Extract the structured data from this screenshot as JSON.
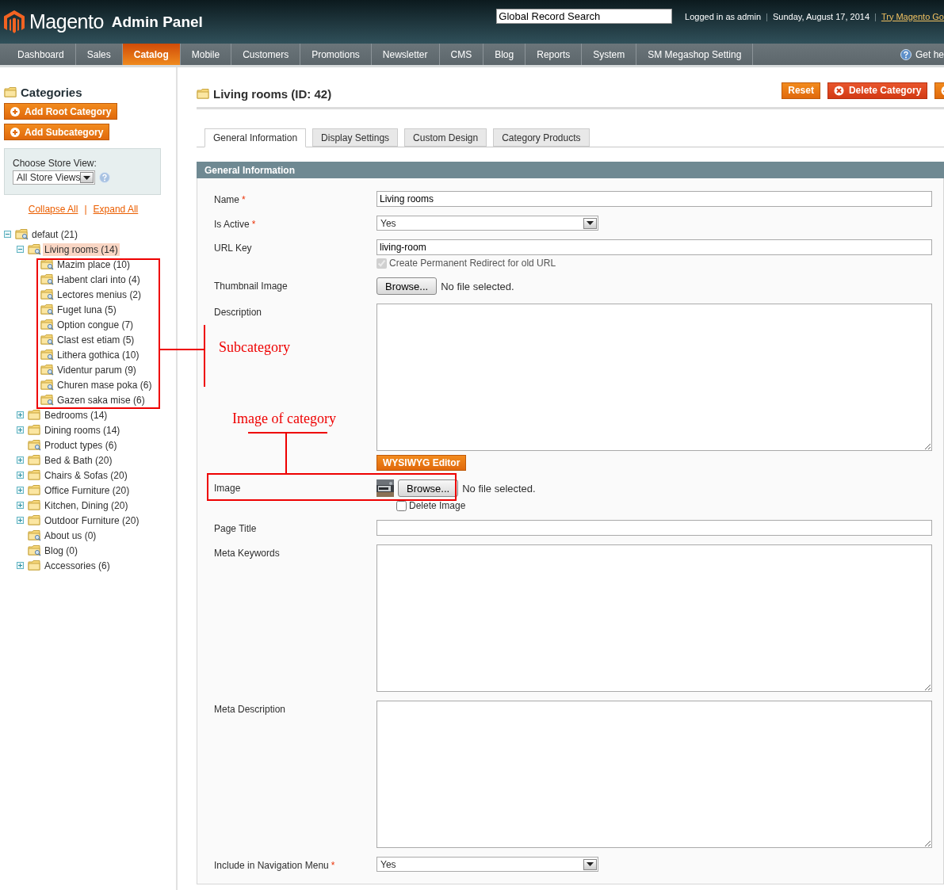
{
  "header": {
    "logo": "Magento",
    "logo_suffix": "Admin Panel",
    "search": {
      "value": "Global Record Search"
    },
    "user_info": "Logged in as admin",
    "separator_1": "|",
    "date": "Sunday, August 17, 2014",
    "separator_2": "|",
    "link": "Try Magento Go"
  },
  "nav": {
    "items": [
      {
        "label": "Dashboard",
        "selected": false
      },
      {
        "label": "Sales",
        "selected": false
      },
      {
        "label": "Catalog",
        "selected": true
      },
      {
        "label": "Mobile",
        "selected": false
      },
      {
        "label": "Customers",
        "selected": false
      },
      {
        "label": "Promotions",
        "selected": false
      },
      {
        "label": "Newsletter",
        "selected": false
      },
      {
        "label": "CMS",
        "selected": false
      },
      {
        "label": "Blog",
        "selected": false
      },
      {
        "label": "Reports",
        "selected": false
      },
      {
        "label": "System",
        "selected": false
      },
      {
        "label": "SM Megashop Setting",
        "selected": false
      }
    ],
    "help": "Get he"
  },
  "sidebar": {
    "title": "Categories",
    "buttons": [
      "Add Root Category",
      "Add Subcategory"
    ],
    "store_view": {
      "label": "Choose Store View:",
      "value": "All Store Views"
    },
    "collapse_all": "Collapse All",
    "links_separator": "|",
    "expand_all": "Expand All",
    "tree": [
      {
        "label": "defaut (21)",
        "kind": "branch",
        "expanded": true,
        "selected": false,
        "children": [
          {
            "label": "Living rooms (14)",
            "kind": "branch",
            "expanded": true,
            "selected": true,
            "children": [
              {
                "label": "Mazim place (10)",
                "kind": "leaf",
                "selected": false
              },
              {
                "label": "Habent clari into (4)",
                "kind": "leaf",
                "selected": false
              },
              {
                "label": "Lectores menius (2)",
                "kind": "leaf",
                "selected": false
              },
              {
                "label": "Fuget luna (5)",
                "kind": "leaf",
                "selected": false
              },
              {
                "label": "Option congue (7)",
                "kind": "leaf",
                "selected": false
              },
              {
                "label": "Clast est etiam (5)",
                "kind": "leaf",
                "selected": false
              },
              {
                "label": "Lithera gothica (10)",
                "kind": "leaf",
                "selected": false
              },
              {
                "label": "Videntur parum (9)",
                "kind": "leaf",
                "selected": false
              },
              {
                "label": "Churen mase poka (6)",
                "kind": "leaf",
                "selected": false
              },
              {
                "label": "Gazen saka mise (6)",
                "kind": "leaf",
                "selected": false
              }
            ]
          },
          {
            "label": "Bedrooms (14)",
            "kind": "branch",
            "expanded": false,
            "selected": false
          },
          {
            "label": "Dining rooms (14)",
            "kind": "branch",
            "expanded": false,
            "selected": false
          },
          {
            "label": "Product types (6)",
            "kind": "leaf",
            "selected": false
          },
          {
            "label": "Bed & Bath (20)",
            "kind": "branch",
            "expanded": false,
            "selected": false
          },
          {
            "label": "Chairs & Sofas (20)",
            "kind": "branch",
            "expanded": false,
            "selected": false
          },
          {
            "label": "Office Furniture (20)",
            "kind": "branch",
            "expanded": false,
            "selected": false
          },
          {
            "label": "Kitchen, Dining (20)",
            "kind": "branch",
            "expanded": false,
            "selected": false
          },
          {
            "label": "Outdoor Furniture (20)",
            "kind": "branch",
            "expanded": false,
            "selected": false
          },
          {
            "label": "About us (0)",
            "kind": "leaf",
            "selected": false
          },
          {
            "label": "Blog (0)",
            "kind": "leaf",
            "selected": false
          },
          {
            "label": "Accessories (6)",
            "kind": "branch",
            "expanded": false,
            "selected": false
          }
        ]
      }
    ]
  },
  "main": {
    "title": "Living rooms (ID: 42)",
    "actions": [
      {
        "label": "Reset",
        "kind": "plain"
      },
      {
        "label": "Delete Category",
        "kind": "delete"
      },
      {
        "kind": "save"
      }
    ],
    "tabs": [
      {
        "label": "General Information",
        "selected": true
      },
      {
        "label": "Display Settings",
        "selected": false
      },
      {
        "label": "Custom Design",
        "selected": false
      },
      {
        "label": "Category Products",
        "selected": false
      }
    ],
    "section_title": "General Information",
    "fields": [
      {
        "label": "Name",
        "required_mark": "*",
        "kind": "text",
        "value": "Living rooms"
      },
      {
        "label": "Is Active",
        "required_mark": "*",
        "kind": "select",
        "value": "Yes"
      },
      {
        "label": "URL Key",
        "kind": "text",
        "value": "living-room",
        "checkbox": {
          "label": "Create Permanent Redirect for old URL",
          "checked": true,
          "disabled": true
        }
      },
      {
        "label": "Thumbnail Image",
        "kind": "file",
        "button": "Browse...",
        "status": "No file selected."
      },
      {
        "label": "Description",
        "kind": "textarea",
        "button": "WYSIWYG Editor"
      },
      {
        "label": "Image",
        "kind": "file",
        "thumbnail": true,
        "button": "Browse...",
        "status": "No file selected.",
        "checkbox": {
          "label": "Delete Image",
          "checked": false,
          "disabled": false
        }
      },
      {
        "label": "Page Title",
        "kind": "text"
      },
      {
        "label": "Meta Keywords",
        "kind": "textarea"
      },
      {
        "label": "Meta Description",
        "kind": "textarea"
      },
      {
        "label": "Include in Navigation Menu",
        "required_mark": "*",
        "kind": "select",
        "value": "Yes"
      }
    ]
  },
  "annotations": [
    {
      "kind": "tree-box",
      "label": "Subcategory"
    },
    {
      "kind": "field-box",
      "label": "Image of category"
    }
  ]
}
